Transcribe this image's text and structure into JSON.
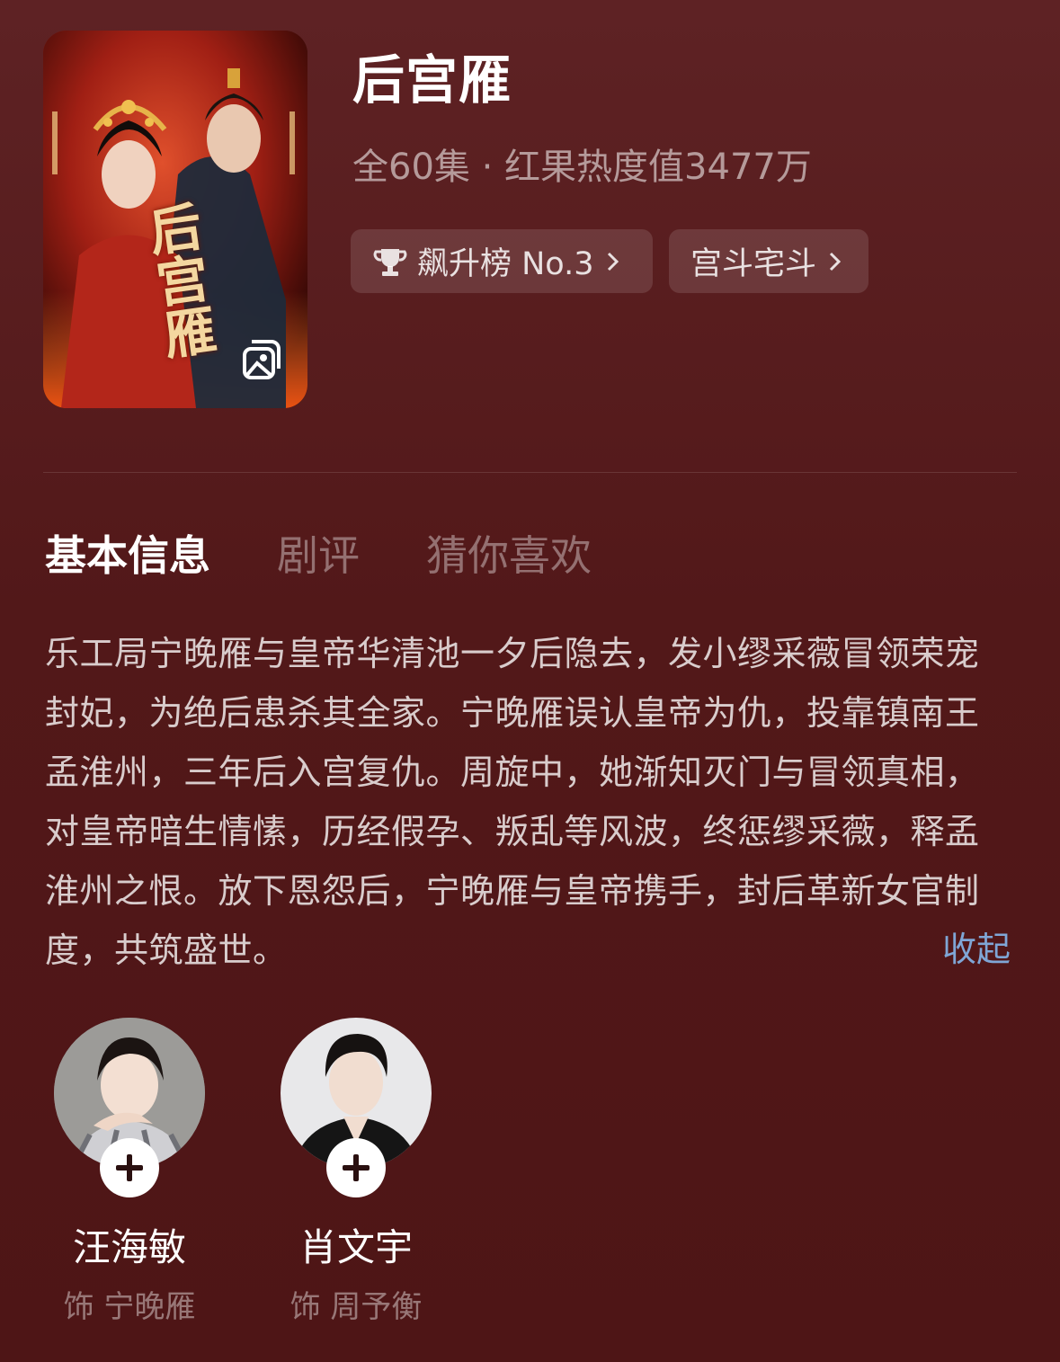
{
  "show": {
    "title": "后宫雁",
    "meta": "全60集 · 红果热度值3477万",
    "poster_title": "后宫雁",
    "rank_chip": "飙升榜 No.3",
    "genre_chip": "宫斗宅斗"
  },
  "tabs": [
    "基本信息",
    "剧评",
    "猜你喜欢"
  ],
  "synopsis": "乐工局宁晚雁与皇帝华清池一夕后隐去，发小缪采薇冒领荣宠封妃，为绝后患杀其全家。宁晚雁误认皇帝为仇，投靠镇南王孟淮州，三年后入宫复仇。周旋中，她渐知灭门与冒领真相，对皇帝暗生情愫，历经假孕、叛乱等风波，终惩缪采薇，释孟淮州之恨。放下恩怨后，宁晚雁与皇帝携手，封后革新女官制度，共筑盛世。",
  "collapse_label": "收起",
  "cast": [
    {
      "name": "汪海敏",
      "role": "饰 宁晚雁"
    },
    {
      "name": "肖文宇",
      "role": "饰 周予衡"
    }
  ],
  "icons": {
    "rank": "trophy-icon",
    "chevron": "chevron-right-icon",
    "gallery": "gallery-icon",
    "follow": "plus-icon"
  },
  "colors": {
    "background": "#561a1b",
    "link": "#7fa6d6"
  }
}
